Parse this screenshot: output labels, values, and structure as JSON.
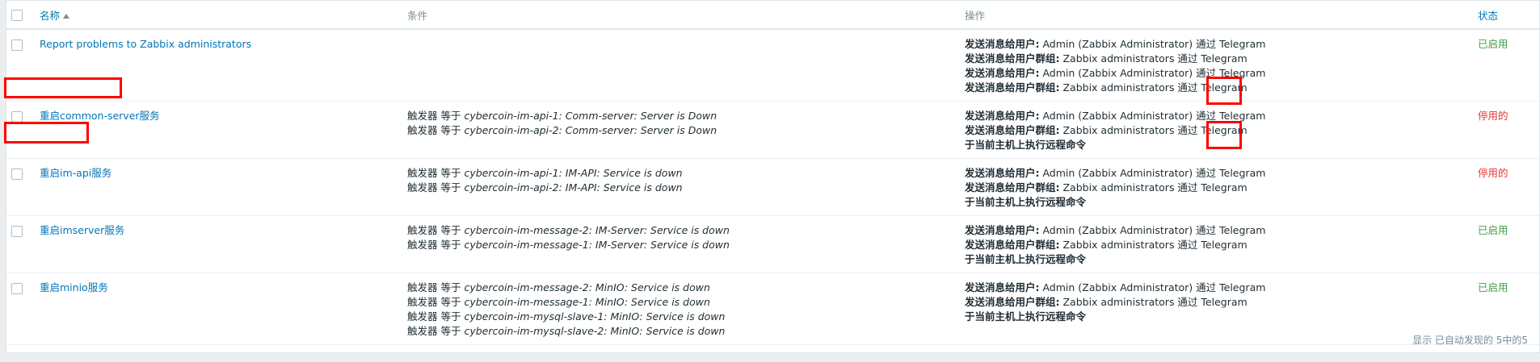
{
  "header": {
    "name_label": "名称",
    "conditions_label": "条件",
    "operations_label": "操作",
    "status_label": "状态"
  },
  "rows": [
    {
      "name": "Report problems to Zabbix administrators",
      "conditions": [],
      "operations": [
        {
          "label": "发送消息给用户:",
          "text": " Admin (Zabbix Administrator) 通过 Telegram"
        },
        {
          "label": "发送消息给用户群组:",
          "text": " Zabbix administrators 通过 Telegram"
        },
        {
          "label": "发送消息给用户:",
          "text": " Admin (Zabbix Administrator) 通过 Telegram"
        },
        {
          "label": "发送消息给用户群组:",
          "text": " Zabbix administrators 通过 Telegram"
        }
      ],
      "status": "已启用",
      "status_type": "enabled"
    },
    {
      "name": "重启common-server服务",
      "conditions": [
        {
          "prefix": "触发器 等于 ",
          "expr": "cybercoin-im-api-1: Comm-server: Server is Down"
        },
        {
          "prefix": "触发器 等于 ",
          "expr": "cybercoin-im-api-2: Comm-server: Server is Down"
        }
      ],
      "operations": [
        {
          "label": "发送消息给用户:",
          "text": " Admin (Zabbix Administrator) 通过 Telegram"
        },
        {
          "label": "发送消息给用户群组:",
          "text": " Zabbix administrators 通过 Telegram"
        },
        {
          "label": "于当前主机上执行远程命令",
          "text": ""
        }
      ],
      "status": "停用的",
      "status_type": "disabled"
    },
    {
      "name": "重启im-api服务",
      "conditions": [
        {
          "prefix": "触发器 等于 ",
          "expr": "cybercoin-im-api-1: IM-API: Service is down"
        },
        {
          "prefix": "触发器 等于 ",
          "expr": "cybercoin-im-api-2: IM-API: Service is down"
        }
      ],
      "operations": [
        {
          "label": "发送消息给用户:",
          "text": " Admin (Zabbix Administrator) 通过 Telegram"
        },
        {
          "label": "发送消息给用户群组:",
          "text": " Zabbix administrators 通过 Telegram"
        },
        {
          "label": "于当前主机上执行远程命令",
          "text": ""
        }
      ],
      "status": "停用的",
      "status_type": "disabled"
    },
    {
      "name": "重启imserver服务",
      "conditions": [
        {
          "prefix": "触发器 等于 ",
          "expr": "cybercoin-im-message-2: IM-Server: Service is down"
        },
        {
          "prefix": "触发器 等于 ",
          "expr": "cybercoin-im-message-1: IM-Server: Service is down"
        }
      ],
      "operations": [
        {
          "label": "发送消息给用户:",
          "text": " Admin (Zabbix Administrator) 通过 Telegram"
        },
        {
          "label": "发送消息给用户群组:",
          "text": " Zabbix administrators 通过 Telegram"
        },
        {
          "label": "于当前主机上执行远程命令",
          "text": ""
        }
      ],
      "status": "已启用",
      "status_type": "enabled"
    },
    {
      "name": "重启minio服务",
      "conditions": [
        {
          "prefix": "触发器 等于 ",
          "expr": "cybercoin-im-message-2: MinIO: Service is down"
        },
        {
          "prefix": "触发器 等于 ",
          "expr": "cybercoin-im-message-1: MinIO: Service is down"
        },
        {
          "prefix": "触发器 等于 ",
          "expr": "cybercoin-im-mysql-slave-1: MinIO: Service is down"
        },
        {
          "prefix": "触发器 等于 ",
          "expr": "cybercoin-im-mysql-slave-2: MinIO: Service is down"
        }
      ],
      "operations": [
        {
          "label": "发送消息给用户:",
          "text": " Admin (Zabbix Administrator) 通过 Telegram"
        },
        {
          "label": "发送消息给用户群组:",
          "text": " Zabbix administrators 通过 Telegram"
        },
        {
          "label": "于当前主机上执行远程命令",
          "text": ""
        }
      ],
      "status": "已启用",
      "status_type": "enabled"
    }
  ],
  "footer": {
    "summary": "显示 已自动发现的 5中的5"
  },
  "colors": {
    "link": "#0275b8",
    "enabled": "#429e47",
    "disabled": "#e33734",
    "highlight": "#ff0000"
  }
}
